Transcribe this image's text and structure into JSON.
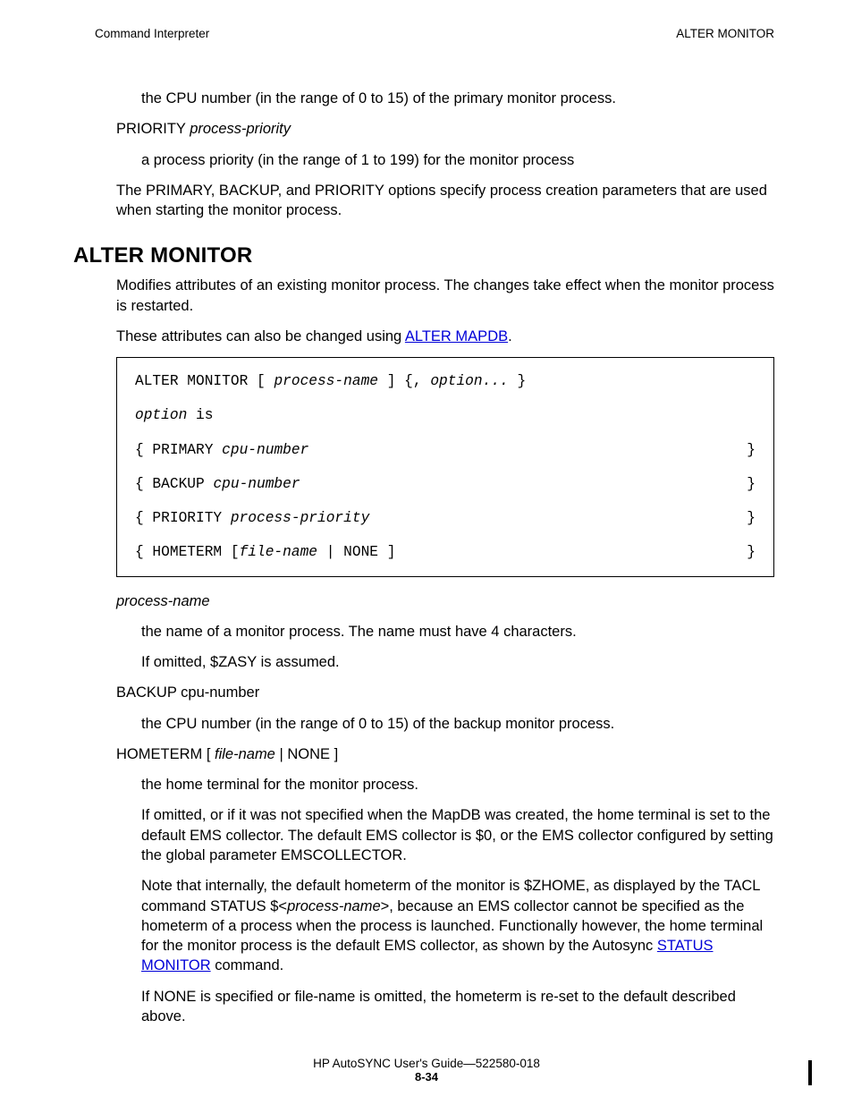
{
  "header": {
    "left": "Command Interpreter",
    "right": "ALTER MONITOR"
  },
  "intro": {
    "cpu_line": "the CPU number (in the range of 0 to 15) of the primary monitor process.",
    "priority_label_a": "PRIORITY ",
    "priority_label_b": "process-priority",
    "priority_desc": "a process priority (in the range of 1 to 199) for the monitor process",
    "primary_backup": "The PRIMARY, BACKUP, and PRIORITY options specify process creation parameters that are used when starting the monitor process."
  },
  "section": {
    "title": "ALTER MONITOR",
    "p1": "Modifies attributes of an existing monitor process. The changes take effect when the monitor process is restarted.",
    "p2a": "These attributes can also be changed using ",
    "p2link": "ALTER MAPDB",
    "p2b": "."
  },
  "syntax": {
    "l1a": "ALTER MONITOR [ ",
    "l1b": "process-name",
    "l1c": " ] {, ",
    "l1d": "option...",
    "l1e": " }",
    "l2a": "option",
    "l2b": " is",
    "r1a": "{ PRIMARY ",
    "r1b": "cpu-number",
    "r1z": "}",
    "r2a": "{ BACKUP ",
    "r2b": "cpu-number",
    "r2z": "}",
    "r3a": "{ PRIORITY ",
    "r3b": "process-priority",
    "r3z": "}",
    "r4a": "{ HOMETERM [",
    "r4b": "file-name",
    "r4c": " | NONE ]",
    "r4z": "}"
  },
  "defs": {
    "pn_label": "process-name",
    "pn_d1": "the name of a monitor process. The name must have 4 characters.",
    "pn_d2": "If omitted, $ZASY is assumed.",
    "bk_label": "BACKUP cpu-number",
    "bk_d1": "the CPU number (in the range of 0 to 15) of the backup monitor process.",
    "ht_label_a": "HOMETERM [ ",
    "ht_label_b": "file-name",
    "ht_label_c": " | NONE ]",
    "ht_d1": "the home terminal for the monitor process.",
    "ht_d2": "If omitted, or if it was not specified when the MapDB was created, the home terminal is set to the default EMS collector. The default EMS collector is $0, or the EMS collector configured by setting the global parameter EMSCOLLECTOR.",
    "ht_d3a": "Note that internally, the default hometerm of the monitor is $ZHOME, as displayed by the TACL command STATUS $<",
    "ht_d3b": "process-name",
    "ht_d3c": ">, because an EMS collector cannot be specified as the hometerm of a process when the process is launched. Functionally however, the home terminal for the monitor process is the default EMS collector, as shown by the Autosync ",
    "ht_d3link": "STATUS MONITOR",
    "ht_d3d": " command.",
    "ht_d4": "If NONE is specified or file-name is omitted, the hometerm is re-set to the default described above."
  },
  "footer": {
    "line1": "HP AutoSYNC User's Guide—522580-018",
    "page": "8-34"
  }
}
